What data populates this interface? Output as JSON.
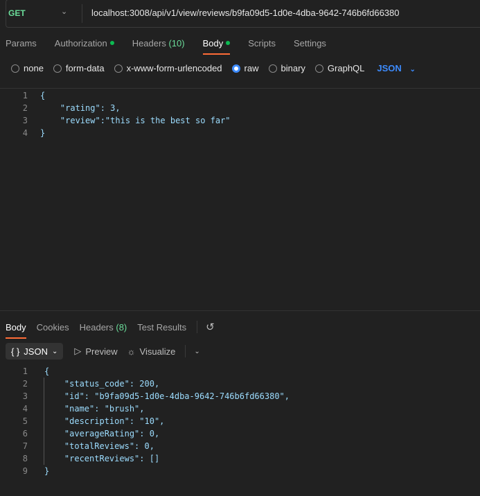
{
  "request": {
    "method": "GET",
    "url": "localhost:3008/api/v1/view/reviews/b9fa09d5-1d0e-4dba-9642-746b6fd66380",
    "tabs": [
      {
        "label": "Params"
      },
      {
        "label": "Authorization",
        "dot": true
      },
      {
        "label": "Headers",
        "count": "(10)"
      },
      {
        "label": "Body",
        "dot": true,
        "active": true
      },
      {
        "label": "Scripts"
      },
      {
        "label": "Settings"
      }
    ],
    "body_types": [
      {
        "label": "none"
      },
      {
        "label": "form-data"
      },
      {
        "label": "x-www-form-urlencoded"
      },
      {
        "label": "raw",
        "selected": true
      },
      {
        "label": "binary"
      },
      {
        "label": "GraphQL"
      }
    ],
    "format": "JSON",
    "body_lines": [
      "{",
      "    \"rating\": 3,",
      "    \"review\":\"this is the best so far\"",
      "}"
    ]
  },
  "response": {
    "tabs": [
      {
        "label": "Body",
        "active": true
      },
      {
        "label": "Cookies"
      },
      {
        "label": "Headers",
        "count": "(8)"
      },
      {
        "label": "Test Results"
      }
    ],
    "format": "JSON",
    "preview": "Preview",
    "visualize": "Visualize",
    "body_lines": [
      "{",
      "    \"status_code\": 200,",
      "    \"id\": \"b9fa09d5-1d0e-4dba-9642-746b6fd66380\",",
      "    \"name\": \"brush\",",
      "    \"description\": \"10\",",
      "    \"averageRating\": 0,",
      "    \"totalReviews\": 0,",
      "    \"recentReviews\": []",
      "}"
    ]
  },
  "colors": {
    "accent": "#ff6c37",
    "method": "#6bdd9a",
    "link": "#3d8bfd"
  }
}
